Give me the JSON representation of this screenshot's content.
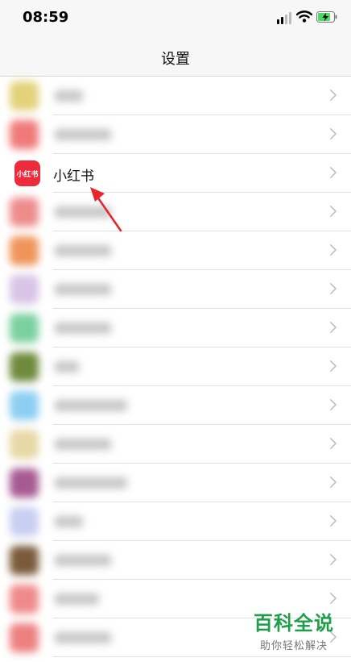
{
  "status_bar": {
    "time": "08:59"
  },
  "header": {
    "title": "设置"
  },
  "settings_list": {
    "rows": [
      {
        "blurred": true,
        "icon_color": "#e3d27a",
        "label_width": 35
      },
      {
        "blurred": true,
        "icon_color": "#f07a7a",
        "label_width": 70
      },
      {
        "blurred": false,
        "icon_text": "小红书",
        "icon_color": "#ee2b3b",
        "label": "小红书"
      },
      {
        "blurred": true,
        "icon_color": "#ee8c8c",
        "label_width": 70
      },
      {
        "blurred": true,
        "icon_color": "#f0945a",
        "label_width": 70
      },
      {
        "blurred": true,
        "icon_color": "#d8c4e6",
        "label_width": 70
      },
      {
        "blurred": true,
        "icon_color": "#7bd0a0",
        "label_width": 70
      },
      {
        "blurred": true,
        "icon_color": "#6f8a3c",
        "label_width": 30
      },
      {
        "blurred": true,
        "icon_color": "#8ccff2",
        "label_width": 90
      },
      {
        "blurred": true,
        "icon_color": "#e8d8a6",
        "label_width": 70
      },
      {
        "blurred": true,
        "icon_color": "#a65a92",
        "label_width": 90
      },
      {
        "blurred": true,
        "icon_color": "#c8cff2",
        "label_width": 35
      },
      {
        "blurred": true,
        "icon_color": "#7a5a3a",
        "label_width": 70
      },
      {
        "blurred": true,
        "icon_color": "#f08a8a",
        "label_width": 55
      },
      {
        "blurred": true,
        "icon_color": "#ee8080",
        "label_width": 70
      }
    ]
  },
  "annotation": {
    "arrow_color": "#e8262c"
  },
  "watermark": {
    "main": "百科全说",
    "sub": "助你轻松解决"
  }
}
